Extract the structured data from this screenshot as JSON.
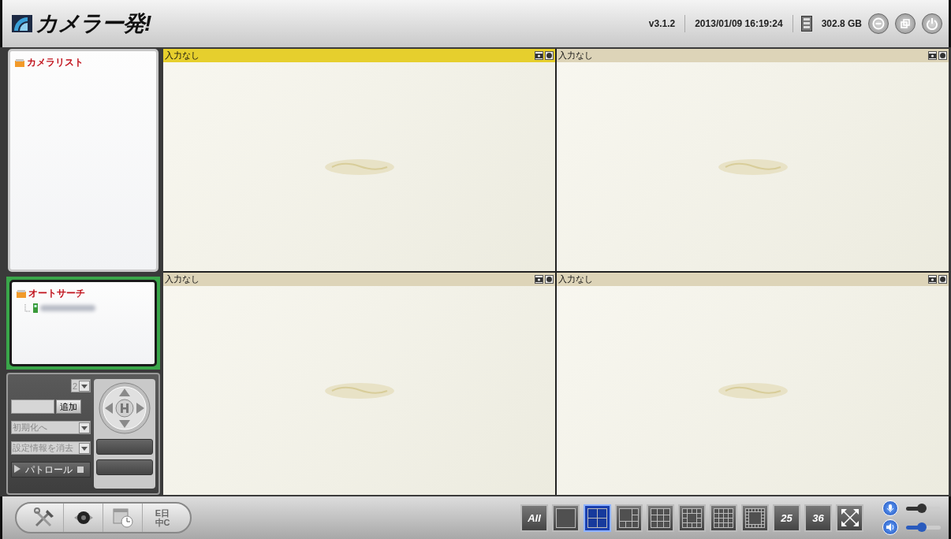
{
  "app": {
    "title": "カメラー発!",
    "version": "v3.1.2",
    "datetime": "2013/01/09 16:19:24",
    "storage": "302.8 GB"
  },
  "window_buttons": [
    {
      "kind": "minimize"
    },
    {
      "kind": "restore"
    },
    {
      "kind": "power"
    }
  ],
  "camera_list": {
    "title": "カメラリスト"
  },
  "auto_search": {
    "title": "オートサーチ",
    "highlighted": true,
    "devices": [
      {
        "kind": "blurred"
      }
    ]
  },
  "ptz": {
    "speed_value": "2",
    "add_button": "追加",
    "preset_select": "初期化へ",
    "clear_select": "設定情報を消去",
    "patrol_label": "パトロール"
  },
  "tiles": [
    {
      "status": "入力なし",
      "selected": true
    },
    {
      "status": "入力なし",
      "selected": false
    },
    {
      "status": "入力なし",
      "selected": false
    },
    {
      "status": "入力なし",
      "selected": false
    }
  ],
  "bottom_tools": [
    {
      "kind": "tools"
    },
    {
      "kind": "camera"
    },
    {
      "kind": "schedule"
    },
    {
      "kind": "language",
      "label_lines": [
        "E日",
        "中C"
      ]
    }
  ],
  "layouts": [
    {
      "kind": "all",
      "label": "All",
      "selected": false
    },
    {
      "kind": "single",
      "selected": false
    },
    {
      "kind": "quad",
      "selected": true
    },
    {
      "kind": "six",
      "selected": false
    },
    {
      "kind": "nine",
      "selected": false
    },
    {
      "kind": "ring13",
      "selected": false
    },
    {
      "kind": "sixteen",
      "selected": false
    },
    {
      "kind": "ring",
      "selected": false
    },
    {
      "kind": "count",
      "label": "25",
      "selected": false
    },
    {
      "kind": "count",
      "label": "36",
      "selected": false
    },
    {
      "kind": "fullscreen",
      "selected": false
    }
  ],
  "audio": [
    {
      "kind": "microphone",
      "level": 0.45
    },
    {
      "kind": "speaker",
      "level": 0.45
    }
  ]
}
